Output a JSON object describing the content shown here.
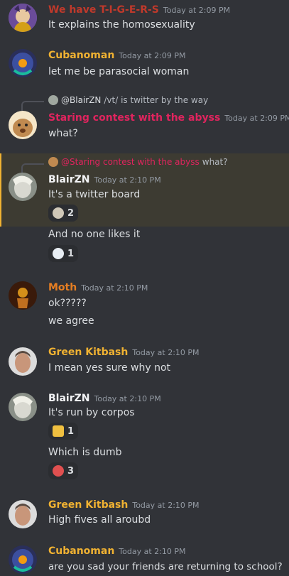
{
  "colors": {
    "bg": "#313338",
    "tigers": "#c0392b",
    "gold": "#f0b232",
    "pink": "#e0245e",
    "white": "#f2f3f5",
    "orange": "#e67e22",
    "mention": "#e0245e"
  },
  "messages": [
    {
      "author": "We have T-I-G-E-R-S",
      "time": "Today at 2:09 PM",
      "text": "It explains the homosexuality"
    },
    {
      "author": "Cubanoman",
      "time": "Today at 2:09 PM",
      "text": "let me be parasocial woman"
    },
    {
      "reply_author": "@BlairZN",
      "reply_text": "/vt/ is twitter by the way",
      "author": "Staring contest with the abyss",
      "time": "Today at 2:09 PM",
      "text": "what?"
    },
    {
      "reply_author": "@Staring contest with the abyss",
      "reply_text": "what?",
      "author": "BlairZN",
      "time": "Today at 2:10 PM",
      "text": "It's a twitter board",
      "reaction_count": "2",
      "text2": "And no one likes it",
      "reaction2_count": "1"
    },
    {
      "author": "Moth",
      "time": "Today at 2:10 PM",
      "text": "ok?????",
      "text2": "we agree"
    },
    {
      "author": "Green Kitbash",
      "time": "Today at 2:10 PM",
      "text": "I mean yes sure why not"
    },
    {
      "author": "BlairZN",
      "time": "Today at 2:10 PM",
      "text": "It's run by corpos",
      "reaction_count": "1",
      "text2": "Which is dumb",
      "reaction2_count": "3"
    },
    {
      "author": "Green Kitbash",
      "time": "Today at 2:10 PM",
      "text": "High fives all aroubd"
    },
    {
      "author": "Cubanoman",
      "time": "Today at 2:10 PM",
      "text": "are you sad your friends are returning to school?"
    }
  ]
}
